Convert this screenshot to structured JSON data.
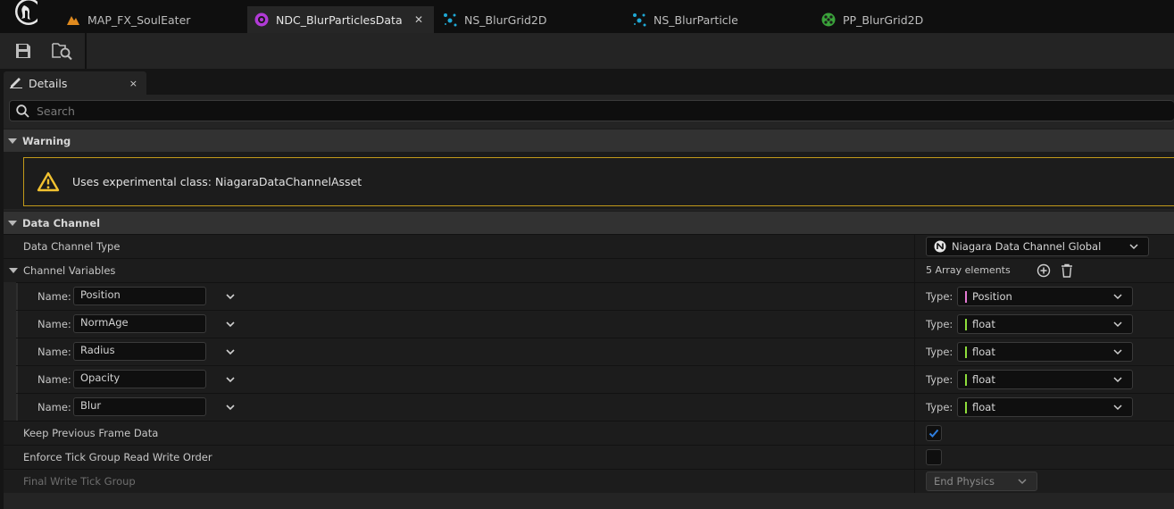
{
  "tabs": [
    {
      "label": "MAP_FX_SoulEater",
      "icon": "map-icon",
      "color": "#e08a1e"
    },
    {
      "label": "NDC_BlurParticlesData",
      "icon": "data-channel-icon",
      "color": "#b13ad6",
      "active": true
    },
    {
      "label": "NS_BlurGrid2D",
      "icon": "niagara-system-icon",
      "color": "#1fa9d6"
    },
    {
      "label": "NS_BlurParticle",
      "icon": "niagara-system-icon",
      "color": "#1fa9d6"
    },
    {
      "label": "PP_BlurGrid2D",
      "icon": "parameter-collection-icon",
      "color": "#3aa33a"
    }
  ],
  "panel": {
    "tab_label": "Details",
    "close": "×"
  },
  "search": {
    "placeholder": "Search"
  },
  "warning": {
    "header": "Warning",
    "message": "Uses experimental class: NiagaraDataChannelAsset",
    "border_color": "#c29a1a"
  },
  "data_channel": {
    "header": "Data Channel",
    "type_label": "Data Channel Type",
    "type_value": "Niagara Data Channel Global",
    "variables_label": "Channel Variables",
    "array_count": "5 Array elements",
    "variables": [
      {
        "name_label": "Name:",
        "name": "Position",
        "type_label": "Type:",
        "type": "Position",
        "pin_color": "#e57ad4"
      },
      {
        "name_label": "Name:",
        "name": "NormAge",
        "type_label": "Type:",
        "type": "float",
        "pin_color": "#8ede3b"
      },
      {
        "name_label": "Name:",
        "name": "Radius",
        "type_label": "Type:",
        "type": "float",
        "pin_color": "#8ede3b"
      },
      {
        "name_label": "Name:",
        "name": "Opacity",
        "type_label": "Type:",
        "type": "float",
        "pin_color": "#8ede3b"
      },
      {
        "name_label": "Name:",
        "name": "Blur",
        "type_label": "Type:",
        "type": "float",
        "pin_color": "#8ede3b"
      }
    ],
    "keep_prev_label": "Keep Previous Frame Data",
    "keep_prev_checked": true,
    "enforce_label": "Enforce Tick Group Read Write Order",
    "enforce_checked": false,
    "final_write_label": "Final Write Tick Group",
    "final_write_value": "End Physics"
  }
}
